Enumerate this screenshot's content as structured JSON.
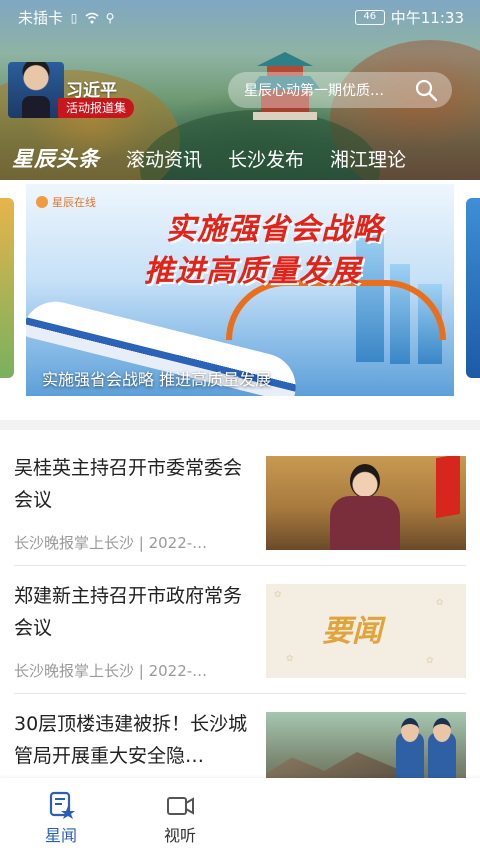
{
  "status_bar": {
    "carrier": "未插卡",
    "battery": "46",
    "time": "中午11:33"
  },
  "header": {
    "feature_name": "习近平",
    "feature_ribbon": "活动报道集",
    "search_placeholder": "星辰心动第一期优质…",
    "tabs": [
      {
        "label": "星辰头条",
        "active": true
      },
      {
        "label": "滚动资讯",
        "active": false
      },
      {
        "label": "长沙发布",
        "active": false
      },
      {
        "label": "湘江理论",
        "active": false
      }
    ]
  },
  "banner": {
    "brand": "星辰在线",
    "headline_line1": "实施强省会战略",
    "headline_line2": "推进高质量发展",
    "caption": "实施强省会战略 推进高质量发展"
  },
  "news": [
    {
      "title": "吴桂英主持召开市委常委会会议",
      "meta": "长沙晚报掌上长沙 | 2022-…"
    },
    {
      "title": "郑建新主持召开市政府常务会议",
      "meta": "长沙晚报掌上长沙 | 2022-…",
      "thumb_text": "要闻"
    },
    {
      "title": "30层顶楼违建被拆！长沙城管局开展重大安全隐…",
      "meta": ""
    }
  ],
  "bottom_nav": [
    {
      "label": "星闻",
      "icon": "news-star-icon",
      "active": true
    },
    {
      "label": "视听",
      "icon": "video-camera-icon",
      "active": false
    }
  ],
  "colors": {
    "accent_blue": "#2a5fb8",
    "headline_red": "#e2231a",
    "ribbon_red": "#c8161d"
  }
}
